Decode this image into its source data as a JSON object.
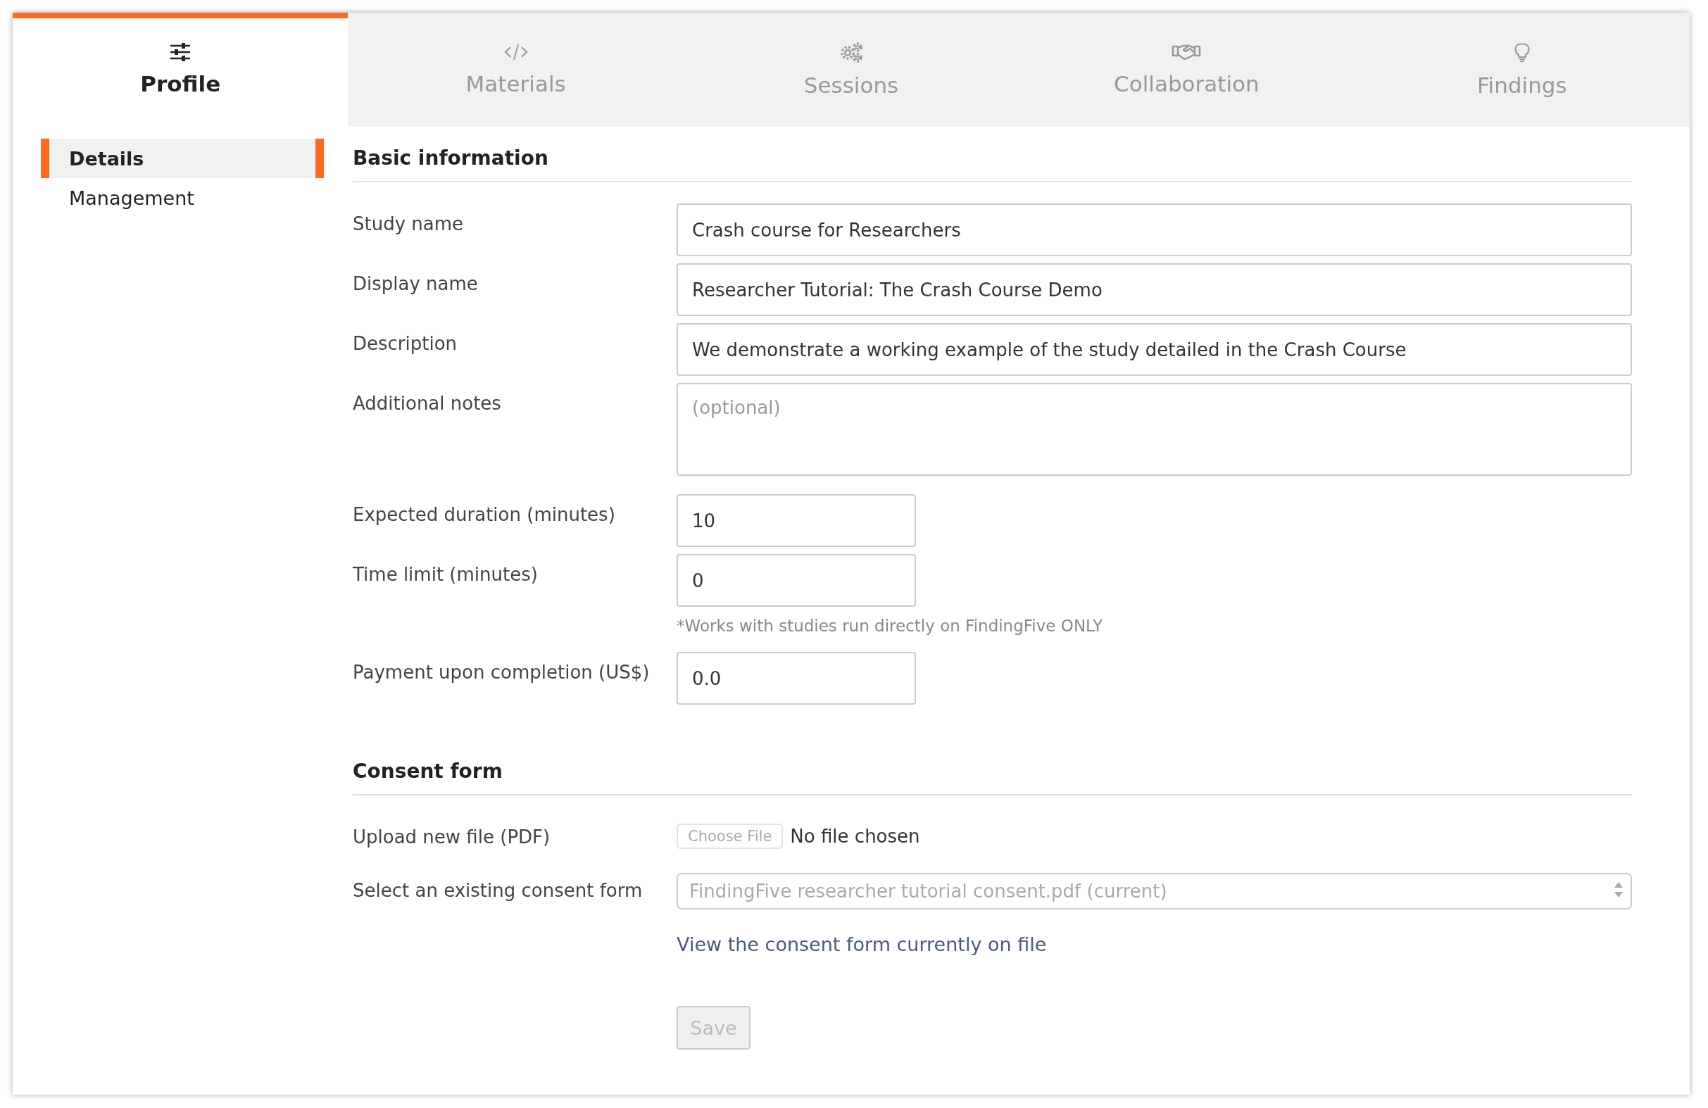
{
  "tabs": [
    {
      "label": "Profile",
      "selected": true
    },
    {
      "label": "Materials",
      "selected": false
    },
    {
      "label": "Sessions",
      "selected": false
    },
    {
      "label": "Collaboration",
      "selected": false
    },
    {
      "label": "Findings",
      "selected": false
    }
  ],
  "sidebar": {
    "items": [
      {
        "label": "Details",
        "selected": true
      },
      {
        "label": "Management",
        "selected": false
      }
    ]
  },
  "sections": [
    {
      "title": "Basic information",
      "rows": [
        {
          "kind": "text",
          "label": "Study name",
          "value": "Crash course for Researchers"
        },
        {
          "kind": "text",
          "label": "Display name",
          "value": "Researcher Tutorial: The Crash Course Demo"
        },
        {
          "kind": "text",
          "label": "Description",
          "value": "We demonstrate a working example of the study detailed in the Crash Course"
        },
        {
          "kind": "textarea",
          "label": "Additional notes",
          "placeholder": "(optional)"
        },
        {
          "kind": "short",
          "label": "Expected duration (minutes)",
          "value": "10"
        },
        {
          "kind": "short",
          "label": "Time limit (minutes)",
          "value": "0",
          "note": "*Works with studies run directly on FindingFive ONLY"
        },
        {
          "kind": "short",
          "label": "Payment upon completion (US$)",
          "value": "0.0"
        }
      ]
    },
    {
      "title": "Consent form",
      "rows": [
        {
          "kind": "file",
          "label": "Upload new file (PDF)",
          "button": "Choose File",
          "status": "No file chosen"
        },
        {
          "kind": "select",
          "label": "Select an existing consent form",
          "value": "FindingFive researcher tutorial consent.pdf (current)",
          "disabled": true
        },
        {
          "kind": "link",
          "text": "View the consent form currently on file"
        }
      ]
    }
  ],
  "save": {
    "label": "Save",
    "disabled": true
  }
}
